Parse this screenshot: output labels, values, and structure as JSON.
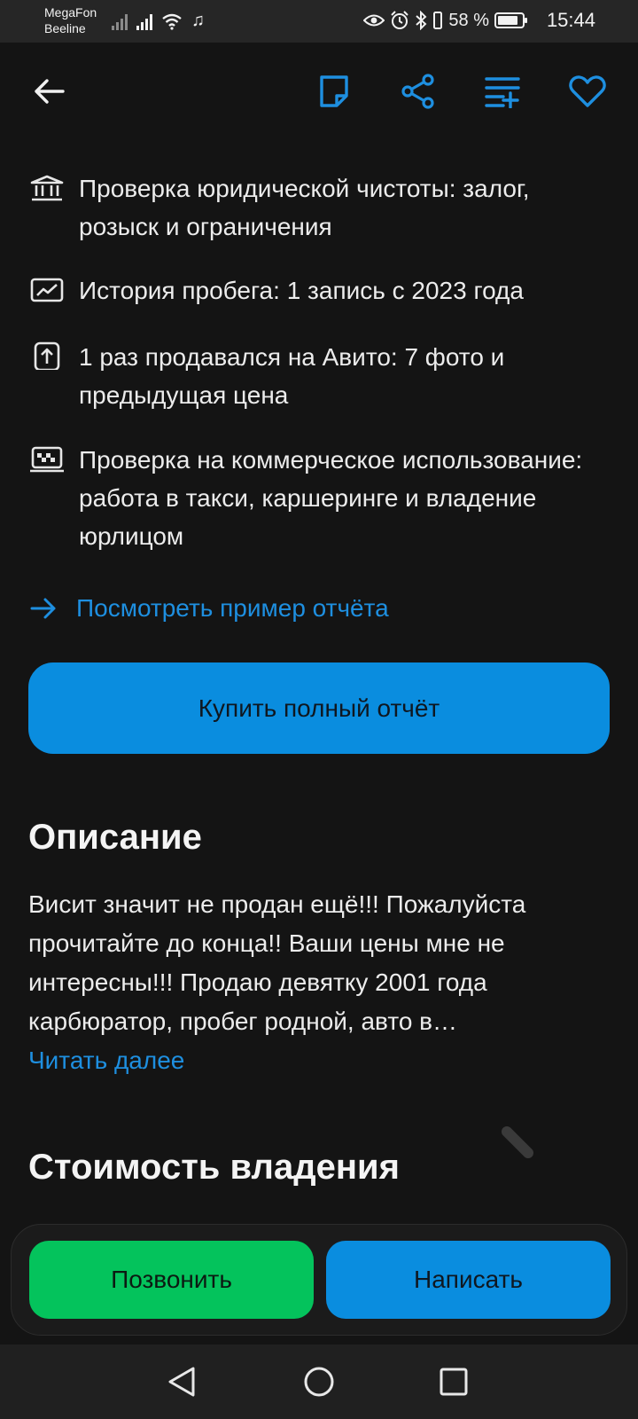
{
  "status_bar": {
    "carrier_1": "MegaFon",
    "carrier_2": "Beeline",
    "battery_text": "58 %",
    "time": "15:44",
    "icons": [
      "signal-icon",
      "signal-icon",
      "wifi-icon",
      "music-icon",
      "eye-icon",
      "alarm-icon",
      "bluetooth-icon",
      "vibrate-icon",
      "battery-icon"
    ]
  },
  "header": {
    "icons": [
      "back-icon",
      "note-icon",
      "share-icon",
      "compare-icon",
      "favorite-icon"
    ]
  },
  "report": {
    "features": [
      {
        "icon": "bank-icon",
        "text": "Проверка юридической чистоты: залог, розыск и ограничения"
      },
      {
        "icon": "chart-icon",
        "text": "История пробега: 1 запись с 2023 года"
      },
      {
        "icon": "upload-icon",
        "text": "1 раз продавался на Авито: 7 фото и предыдущая цена"
      },
      {
        "icon": "taxi-icon",
        "text": "Проверка на коммерческое использование: работа в такси, каршеринге и владение юрлицом"
      }
    ],
    "sample_link": "Посмотреть пример отчёта",
    "buy_button": "Купить полный отчёт"
  },
  "description": {
    "title": "Описание",
    "text": "Висит значит не продан ещё!!! Пожалуйста прочитайте до конца!! Ваши цены мне не интересны!!! Продаю девятку 2001 года карбюратор, пробег родной, авто  в…",
    "read_more": "Читать далее"
  },
  "ownership": {
    "title": "Стоимость владения"
  },
  "actions": {
    "call": "Позвонить",
    "write": "Написать"
  },
  "nav": {
    "icons": [
      "back-triangle-icon",
      "home-circle-icon",
      "recents-square-icon"
    ]
  },
  "colors": {
    "background": "#141414",
    "accent_blue": "#0a8ddf",
    "link_blue": "#1e8fe0",
    "call_green": "#04c35c"
  }
}
